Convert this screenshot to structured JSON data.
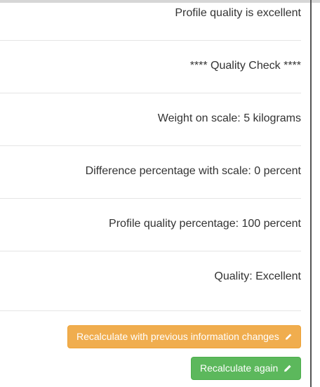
{
  "rows": {
    "profile_quality": "Profile quality is excellent",
    "quality_check": "**** Quality Check ****",
    "weight": "Weight on scale: 5 kilograms",
    "difference": "Difference percentage with scale: 0 percent",
    "profile_percentage": "Profile quality percentage: 100 percent",
    "quality": "Quality: Excellent"
  },
  "buttons": {
    "recalc_previous": "Recalculate with previous information changes",
    "recalc_again": "Recalculate again"
  },
  "icons": {
    "button_icon": "pencil-icon"
  },
  "colors": {
    "warning": "#f0ad4e",
    "success": "#5cb85c"
  }
}
